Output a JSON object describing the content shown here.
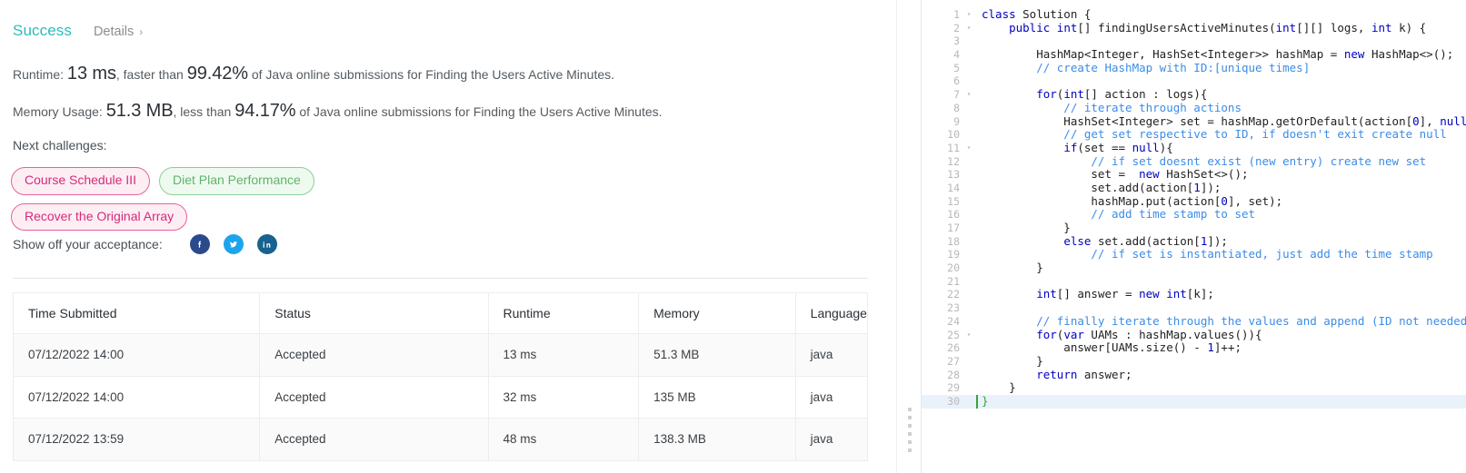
{
  "result": {
    "status_label": "Success",
    "details_label": "Details",
    "details_chevron": "chevron-right-icon",
    "runtime": {
      "prefix": "Runtime:",
      "value": "13 ms",
      "mid": ", faster than",
      "percent": "99.42%",
      "suffix": "of Java online submissions for Finding the Users Active Minutes."
    },
    "memory": {
      "prefix": "Memory Usage:",
      "value": "51.3 MB",
      "mid": ", less than",
      "percent": "94.17%",
      "suffix": "of Java online submissions for Finding the Users Active Minutes."
    }
  },
  "next_challenges": {
    "label": "Next challenges:",
    "items": [
      {
        "label": "Course Schedule III",
        "style": "pink"
      },
      {
        "label": "Diet Plan Performance",
        "style": "green"
      },
      {
        "label": "Recover the Original Array",
        "style": "pink"
      }
    ]
  },
  "share": {
    "label": "Show off your acceptance:",
    "networks": [
      {
        "name": "facebook-icon",
        "color": "#2b4a8b"
      },
      {
        "name": "twitter-icon",
        "color": "#1ea4ef"
      },
      {
        "name": "linkedin-icon",
        "color": "#17628f"
      }
    ]
  },
  "submissions_table": {
    "columns": [
      "Time Submitted",
      "Status",
      "Runtime",
      "Memory",
      "Language"
    ],
    "rows": [
      {
        "time": "07/12/2022 14:00",
        "status": "Accepted",
        "runtime": "13 ms",
        "memory": "51.3 MB",
        "language": "java"
      },
      {
        "time": "07/12/2022 14:00",
        "status": "Accepted",
        "runtime": "32 ms",
        "memory": "135 MB",
        "language": "java"
      },
      {
        "time": "07/12/2022 13:59",
        "status": "Accepted",
        "runtime": "48 ms",
        "memory": "138.3 MB",
        "language": "java"
      }
    ]
  },
  "colors": {
    "success": "#2cbcbc",
    "accepted": "#19a0a0",
    "chip_pink_text": "#d62a78",
    "chip_pink_border": "#e8609b",
    "chip_green_text": "#62b36d",
    "chip_green_border": "#8bcf94",
    "comment": "#3c8ce7",
    "keyword": "#0000c0",
    "active_line": "#e9f2fb",
    "brace_match": "#3ca03c"
  },
  "editor": {
    "language": "java",
    "active_line": 30,
    "fold_lines": [
      1,
      2,
      7,
      11,
      25
    ],
    "lines": [
      {
        "n": 1,
        "tokens": [
          {
            "t": "class ",
            "c": "k"
          },
          {
            "t": "Solution ",
            "c": "nm"
          },
          {
            "t": "{",
            "c": "nm"
          }
        ]
      },
      {
        "n": 2,
        "tokens": [
          {
            "t": "    ",
            "c": "nm"
          },
          {
            "t": "public ",
            "c": "k"
          },
          {
            "t": "int",
            "c": "k"
          },
          {
            "t": "[] findingUsersActiveMinutes(",
            "c": "nm"
          },
          {
            "t": "int",
            "c": "k"
          },
          {
            "t": "[][] logs, ",
            "c": "nm"
          },
          {
            "t": "int",
            "c": "k"
          },
          {
            "t": " k) {",
            "c": "nm"
          }
        ]
      },
      {
        "n": 3,
        "tokens": []
      },
      {
        "n": 4,
        "tokens": [
          {
            "t": "        HashMap<Integer, HashSet<Integer>> hashMap = ",
            "c": "nm"
          },
          {
            "t": "new",
            "c": "k"
          },
          {
            "t": " HashMap<>();",
            "c": "nm"
          }
        ]
      },
      {
        "n": 5,
        "tokens": [
          {
            "t": "        // create HashMap with ID:[unique times]",
            "c": "cm"
          }
        ]
      },
      {
        "n": 6,
        "tokens": []
      },
      {
        "n": 7,
        "tokens": [
          {
            "t": "        ",
            "c": "nm"
          },
          {
            "t": "for",
            "c": "k"
          },
          {
            "t": "(",
            "c": "nm"
          },
          {
            "t": "int",
            "c": "k"
          },
          {
            "t": "[] action : logs){",
            "c": "nm"
          }
        ]
      },
      {
        "n": 8,
        "tokens": [
          {
            "t": "            // iterate through actions",
            "c": "cm"
          }
        ]
      },
      {
        "n": 9,
        "tokens": [
          {
            "t": "            HashSet<Integer> set = hashMap.getOrDefault(action[",
            "c": "nm"
          },
          {
            "t": "0",
            "c": "num"
          },
          {
            "t": "], ",
            "c": "nm"
          },
          {
            "t": "null",
            "c": "k"
          },
          {
            "t": ");",
            "c": "nm"
          }
        ]
      },
      {
        "n": 10,
        "tokens": [
          {
            "t": "            // get set respective to ID, if doesn't exit create null",
            "c": "cm"
          }
        ]
      },
      {
        "n": 11,
        "tokens": [
          {
            "t": "            ",
            "c": "nm"
          },
          {
            "t": "if",
            "c": "k"
          },
          {
            "t": "(set == ",
            "c": "nm"
          },
          {
            "t": "null",
            "c": "k"
          },
          {
            "t": "){",
            "c": "nm"
          }
        ]
      },
      {
        "n": 12,
        "tokens": [
          {
            "t": "                // if set doesnt exist (new entry) create new set",
            "c": "cm"
          }
        ]
      },
      {
        "n": 13,
        "tokens": [
          {
            "t": "                set =  ",
            "c": "nm"
          },
          {
            "t": "new",
            "c": "k"
          },
          {
            "t": " HashSet<>();",
            "c": "nm"
          }
        ]
      },
      {
        "n": 14,
        "tokens": [
          {
            "t": "                set.add(action[",
            "c": "nm"
          },
          {
            "t": "1",
            "c": "num"
          },
          {
            "t": "]);",
            "c": "nm"
          }
        ]
      },
      {
        "n": 15,
        "tokens": [
          {
            "t": "                hashMap.put(action[",
            "c": "nm"
          },
          {
            "t": "0",
            "c": "num"
          },
          {
            "t": "], set);",
            "c": "nm"
          }
        ]
      },
      {
        "n": 16,
        "tokens": [
          {
            "t": "                // add time stamp to set",
            "c": "cm"
          }
        ]
      },
      {
        "n": 17,
        "tokens": [
          {
            "t": "            }",
            "c": "nm"
          }
        ]
      },
      {
        "n": 18,
        "tokens": [
          {
            "t": "            ",
            "c": "nm"
          },
          {
            "t": "else",
            "c": "k"
          },
          {
            "t": " set.add(action[",
            "c": "nm"
          },
          {
            "t": "1",
            "c": "num"
          },
          {
            "t": "]);",
            "c": "nm"
          }
        ]
      },
      {
        "n": 19,
        "tokens": [
          {
            "t": "                // if set is instantiated, just add the time stamp",
            "c": "cm"
          }
        ]
      },
      {
        "n": 20,
        "tokens": [
          {
            "t": "        }",
            "c": "nm"
          }
        ]
      },
      {
        "n": 21,
        "tokens": []
      },
      {
        "n": 22,
        "tokens": [
          {
            "t": "        ",
            "c": "nm"
          },
          {
            "t": "int",
            "c": "k"
          },
          {
            "t": "[] answer = ",
            "c": "nm"
          },
          {
            "t": "new",
            "c": "k"
          },
          {
            "t": " ",
            "c": "nm"
          },
          {
            "t": "int",
            "c": "k"
          },
          {
            "t": "[k];",
            "c": "nm"
          }
        ]
      },
      {
        "n": 23,
        "tokens": []
      },
      {
        "n": 24,
        "tokens": [
          {
            "t": "        // finally iterate through the values and append (ID not needed)",
            "c": "cm"
          }
        ]
      },
      {
        "n": 25,
        "tokens": [
          {
            "t": "        ",
            "c": "nm"
          },
          {
            "t": "for",
            "c": "k"
          },
          {
            "t": "(",
            "c": "nm"
          },
          {
            "t": "var",
            "c": "k"
          },
          {
            "t": " UAMs : hashMap.values()){",
            "c": "nm"
          }
        ]
      },
      {
        "n": 26,
        "tokens": [
          {
            "t": "            answer[UAMs.size() - ",
            "c": "nm"
          },
          {
            "t": "1",
            "c": "num"
          },
          {
            "t": "]++;",
            "c": "nm"
          }
        ]
      },
      {
        "n": 27,
        "tokens": [
          {
            "t": "        }",
            "c": "nm"
          }
        ]
      },
      {
        "n": 28,
        "tokens": [
          {
            "t": "        ",
            "c": "nm"
          },
          {
            "t": "return",
            "c": "k"
          },
          {
            "t": " answer;",
            "c": "nm"
          }
        ]
      },
      {
        "n": 29,
        "tokens": [
          {
            "t": "    }",
            "c": "nm"
          }
        ]
      },
      {
        "n": 30,
        "tokens": [
          {
            "t": "}",
            "c": "br"
          }
        ]
      }
    ]
  },
  "splitter": {
    "name": "pane-resize-handle"
  }
}
